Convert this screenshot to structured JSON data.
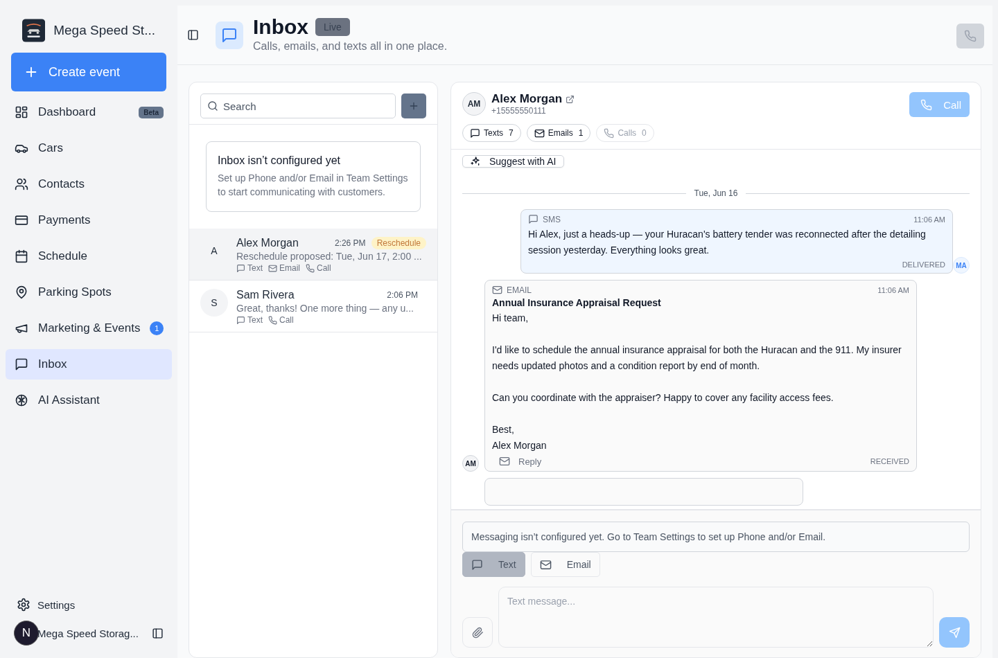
{
  "brand": {
    "name": "Mega Speed St..."
  },
  "create_button": "Create event",
  "nav": [
    {
      "kind": "dashboard",
      "label": "Dashboard",
      "badge": "Beta",
      "selected": false
    },
    {
      "kind": "car",
      "label": "Cars",
      "selected": false
    },
    {
      "kind": "contacts",
      "label": "Contacts",
      "selected": false
    },
    {
      "kind": "payments",
      "label": "Payments",
      "selected": false
    },
    {
      "kind": "schedule",
      "label": "Schedule",
      "selected": false
    },
    {
      "kind": "parking",
      "label": "Parking Spots",
      "selected": false
    },
    {
      "kind": "marketing",
      "label": "Marketing & Events",
      "count": "1",
      "selected": false
    },
    {
      "kind": "inbox",
      "label": "Inbox",
      "selected": true
    },
    {
      "kind": "ai",
      "label": "AI Assistant",
      "selected": false
    }
  ],
  "settings": "Settings",
  "account": {
    "initial": "N",
    "name": "Mega Speed Storag..."
  },
  "header": {
    "title": "Inbox",
    "badge": "Live",
    "subtitle": "Calls, emails, and texts all in one place."
  },
  "inbox_list": {
    "search_placeholder": "Search",
    "notice": {
      "title": "Inbox isn’t configured yet",
      "body": "Set up Phone and/or Email in Team Settings to start communicating with customers."
    },
    "conversations": [
      {
        "initial": "A",
        "name": "Alex Morgan",
        "time": "2:26 PM",
        "tag": "Reschedule",
        "preview": "Reschedule proposed: Tue, Jun 17, 2:00 ...",
        "selected": true,
        "channels": [
          {
            "kind": "text",
            "label": "Text"
          },
          {
            "kind": "email",
            "label": "Email"
          },
          {
            "kind": "call",
            "label": "Call"
          }
        ]
      },
      {
        "initial": "S",
        "name": "Sam Rivera",
        "time": "2:06 PM",
        "preview": "Great, thanks! One more thing — any u...",
        "selected": false,
        "channels": [
          {
            "kind": "text",
            "label": "Text"
          },
          {
            "kind": "call",
            "label": "Call"
          }
        ]
      }
    ]
  },
  "conversation": {
    "initials": "AM",
    "name": "Alex Morgan",
    "phone": "+15555550111",
    "call_button": "Call",
    "counts": [
      {
        "kind": "text",
        "label": "Texts",
        "count": "7",
        "disabled": false
      },
      {
        "kind": "email",
        "label": "Emails",
        "count": "1",
        "disabled": false
      },
      {
        "kind": "call",
        "label": "Calls",
        "count": "0",
        "disabled": true
      }
    ],
    "suggest_button": "Suggest with AI",
    "date": "Tue, Jun 16",
    "messages": [
      {
        "kind": "sms",
        "outgoing": true,
        "label": "SMS",
        "time": "11:06 AM",
        "body": [
          "Hi Alex, just a heads-up — your Huracan's battery tender was reconnected after the detailing session yesterday. Everything looks great."
        ],
        "status": "DELIVERED",
        "avatar": "MA"
      },
      {
        "kind": "email",
        "outgoing": false,
        "label": "EMAIL",
        "time": "11:06 AM",
        "subject": "Annual Insurance Appraisal Request",
        "body": [
          "Hi team,",
          "I'd like to schedule the annual insurance appraisal for both the Huracan and the 911. My insurer needs updated photos and a condition report by end of month.",
          "Can you coordinate with the appraiser? Happy to cover any facility access fees.",
          "Best,\nAlex Morgan"
        ],
        "reply": "Reply",
        "status": "RECEIVED",
        "avatar": "AM"
      },
      {
        "kind": "clipped"
      }
    ]
  },
  "composer": {
    "notice": "Messaging isn’t configured yet. Go to Team Settings to set up Phone and/or Email.",
    "modes": [
      {
        "kind": "text",
        "label": "Text",
        "selected": true
      },
      {
        "kind": "email",
        "label": "Email",
        "selected": false
      }
    ],
    "placeholder": "Text message..."
  }
}
